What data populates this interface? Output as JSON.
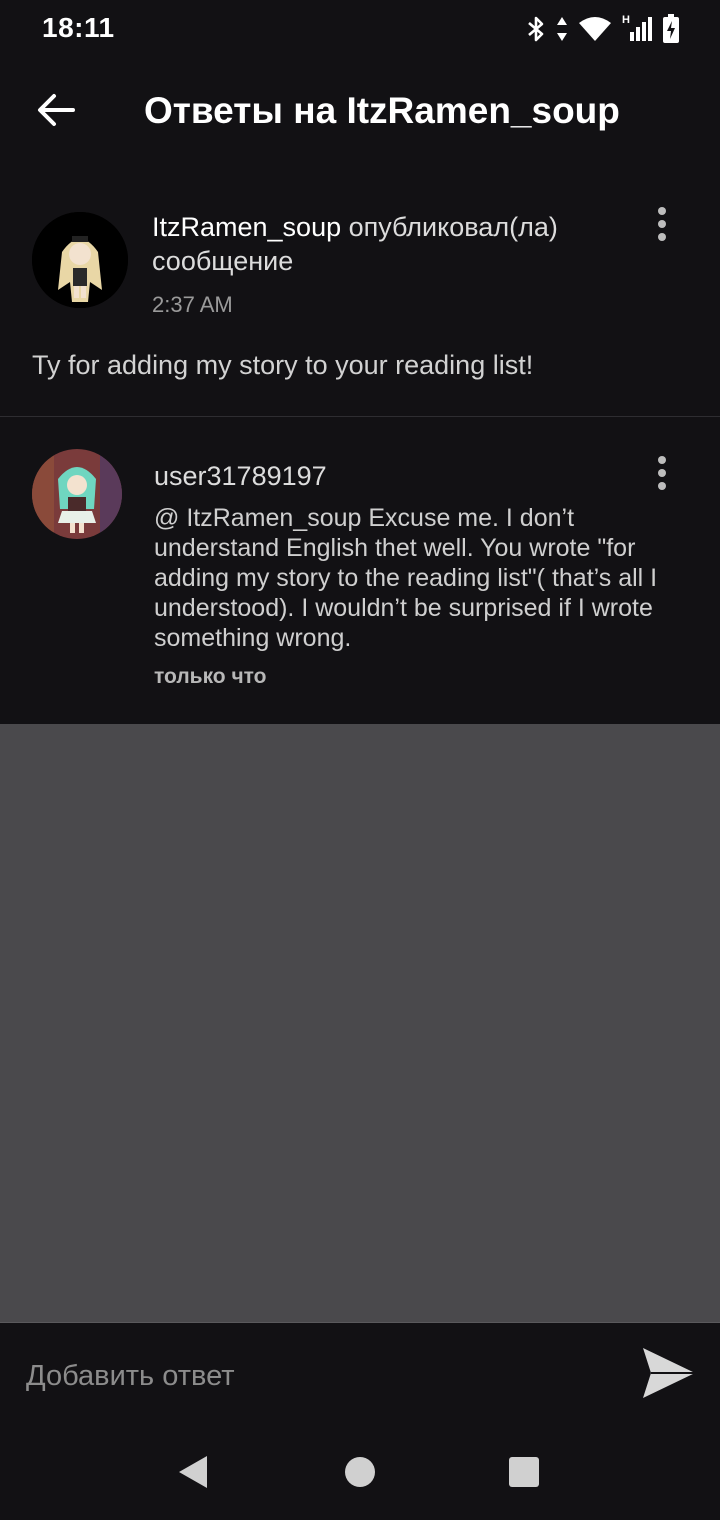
{
  "status_bar": {
    "time": "18:11",
    "network_label": "H",
    "icons": [
      "bluetooth-icon",
      "data-arrows-icon",
      "wifi-icon",
      "cell-signal-icon",
      "battery-charging-icon"
    ]
  },
  "app_bar": {
    "title": "Ответы на ItzRamen_soup",
    "back_icon": "arrow-back-icon"
  },
  "post": {
    "author": "ItzRamen_soup",
    "action": " опубликовал(ла) сообщение",
    "time": "2:37 AM",
    "body": "Ty for adding my story to your reading list!",
    "more_icon": "more-vertical-icon"
  },
  "reply": {
    "author": "user31789197",
    "text": "@ ItzRamen_soup  Excuse me. I don’t understand English thet well. You wrote \"for adding my story to the reading list\"( that’s all I understood). I wouldn’t be surprised if I wrote something wrong.",
    "time": "только что",
    "more_icon": "more-vertical-icon"
  },
  "composer": {
    "placeholder": "Добавить ответ",
    "value": "",
    "send_icon": "send-icon"
  },
  "nav_bar": {
    "icons": [
      "nav-back-icon",
      "nav-home-icon",
      "nav-recents-icon"
    ]
  },
  "colors": {
    "background": "#121114",
    "empty_area": "#4a494c",
    "text_primary": "#ffffff",
    "text_secondary": "#9a9a9a"
  }
}
